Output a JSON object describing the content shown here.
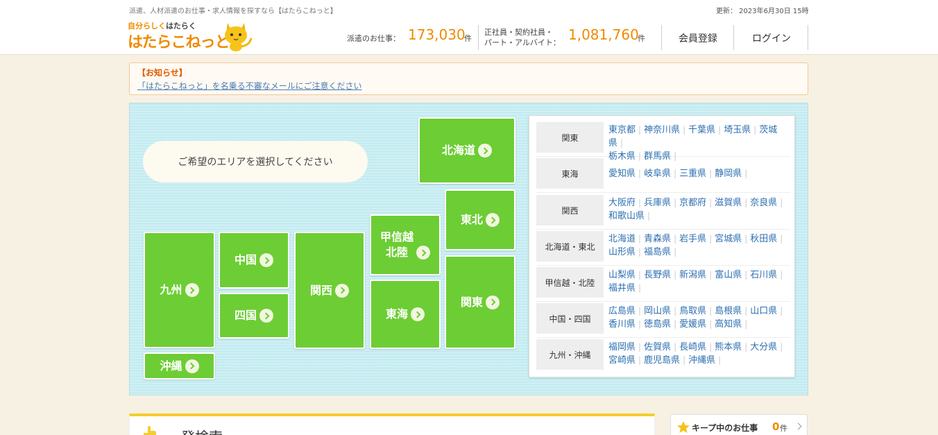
{
  "header": {
    "tagline": "派遣、人材派遣のお仕事・求人情報を探すなら【はたらこねっと】",
    "updated": "更新： 2023年6月30日 15時",
    "logo_small_a": "自分らしく",
    "logo_small_b": "はたらく",
    "logo_main": "はたらこねっと",
    "haken_label": "派遣のお仕事：",
    "haken_count": "173,030",
    "unit": "件",
    "seishain_label_1": "正社員・契約社員・",
    "seishain_label_2": "パート・アルバイト：",
    "seishain_count": "1,081,760",
    "register": "会員登録",
    "login": "ログイン"
  },
  "notice": {
    "title": "【お知らせ】",
    "link": "「はたらこねっと」を名乗る不審なメールにご注意ください"
  },
  "map": {
    "prompt": "ご希望のエリアを選択してください",
    "regions": {
      "hokkaido": "北海道",
      "tohoku": "東北",
      "kanto": "関東",
      "koshinetsu_1": "甲信越",
      "koshinetsu_2": "北陸",
      "tokai": "東海",
      "kansai": "関西",
      "chugoku": "中国",
      "shikoku": "四国",
      "kyushu": "九州",
      "okinawa": "沖縄"
    }
  },
  "prefectures": [
    {
      "area": "関東",
      "items": [
        "東京都",
        "神奈川県",
        "千葉県",
        "埼玉県",
        "茨城県",
        "栃木県",
        "群馬県"
      ]
    },
    {
      "area": "東海",
      "items": [
        "愛知県",
        "岐阜県",
        "三重県",
        "静岡県"
      ]
    },
    {
      "area": "関西",
      "items": [
        "大阪府",
        "兵庫県",
        "京都府",
        "滋賀県",
        "奈良県",
        "和歌山県"
      ]
    },
    {
      "area": "北海道・東北",
      "items": [
        "北海道",
        "青森県",
        "岩手県",
        "宮城県",
        "秋田県",
        "山形県",
        "福島県"
      ]
    },
    {
      "area": "甲信越・北陸",
      "items": [
        "山梨県",
        "長野県",
        "新潟県",
        "富山県",
        "石川県",
        "福井県"
      ]
    },
    {
      "area": "中国・四国",
      "items": [
        "広島県",
        "岡山県",
        "鳥取県",
        "島根県",
        "山口県",
        "香川県",
        "徳島県",
        "愛媛県",
        "高知県"
      ]
    },
    {
      "area": "九州・沖縄",
      "items": [
        "福岡県",
        "佐賀県",
        "長崎県",
        "熊本県",
        "大分県",
        "宮崎県",
        "鹿児島県",
        "沖縄県"
      ]
    }
  ],
  "bottom": {
    "search_title": "一発検索",
    "keep_label": "キープ中のお仕事",
    "keep_count": "0",
    "keep_unit": "件"
  },
  "colors": {
    "accent_orange": "#f08a00",
    "region_green": "#6dcd34",
    "map_bg": "#c4ecf1",
    "link_blue": "#2d6fb1"
  }
}
